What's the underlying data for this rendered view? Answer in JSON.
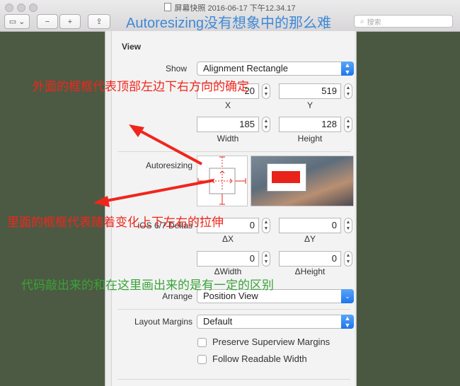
{
  "window": {
    "title": "屏幕快照 2016-06-17 下午12.34.17",
    "search_placeholder": "搜索",
    "overlay_title": "Autoresizing没有想象中的那么难"
  },
  "toolbar": {
    "sidebar_button": "▭",
    "sidebar_chevron": "⌄",
    "zoom_out": "−",
    "zoom_in": "+",
    "share": "⇪"
  },
  "inspector": {
    "section_title": "View",
    "show": {
      "label": "Show",
      "value": "Alignment Rectangle"
    },
    "x": {
      "value": "20",
      "label": "X"
    },
    "y": {
      "value": "519",
      "label": "Y"
    },
    "width": {
      "value": "185",
      "label": "Width"
    },
    "height": {
      "value": "128",
      "label": "Height"
    },
    "autoresizing_label": "Autoresizing",
    "ios_deltas": {
      "label": "iOS 6/7 Deltas",
      "dx": {
        "value": "0",
        "label": "ΔX"
      },
      "dy": {
        "value": "0",
        "label": "ΔY"
      },
      "dwidth": {
        "value": "0",
        "label": "ΔWidth"
      },
      "dheight": {
        "value": "0",
        "label": "ΔHeight"
      }
    },
    "arrange": {
      "label": "Arrange",
      "value": "Position View"
    },
    "layout_margins": {
      "label": "Layout Margins",
      "value": "Default"
    },
    "preserve_superview_margins": {
      "label": "Preserve Superview Margins",
      "checked": false
    },
    "follow_readable_width": {
      "label": "Follow Readable Width",
      "checked": false
    }
  },
  "annotations": {
    "outer_frame": "外面的框框代表顶部左边下右方向的确定",
    "inner_frame": "里面的框框代表随着变化上下左右的拉伸",
    "code_note": "代码敲出来的和在这里画出来的是有一定的区别"
  },
  "colors": {
    "annotation_red": "#f0261c",
    "annotation_green": "#3aa23a",
    "title_blue": "#3e8ad6",
    "popup_blue": "#1c76ee"
  }
}
